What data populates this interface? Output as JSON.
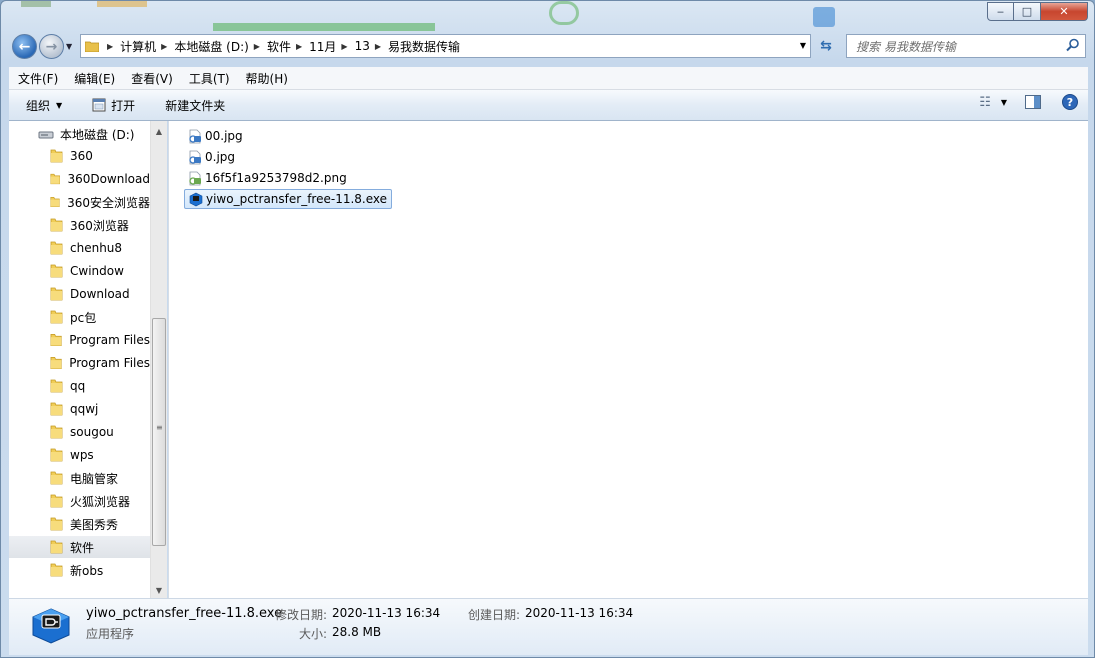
{
  "window": {
    "caption_buttons": {
      "minimize": "‒",
      "maximize": "□",
      "close": "✕"
    }
  },
  "nav": {
    "breadcrumbs": [
      "计算机",
      "本地磁盘 (D:)",
      "软件",
      "11月",
      "13",
      "易我数据传输"
    ],
    "search_placeholder": "搜索 易我数据传输"
  },
  "menu": [
    "文件(F)",
    "编辑(E)",
    "查看(V)",
    "工具(T)",
    "帮助(H)"
  ],
  "commands": {
    "organize": "组织",
    "open": "打开",
    "new_folder": "新建文件夹"
  },
  "sidebar": {
    "drive": "本地磁盘 (D:)",
    "folders": [
      "360",
      "360Download",
      "360安全浏览器",
      "360浏览器",
      "chenhu8",
      "Cwindow",
      "Download",
      "pc包",
      "Program Files",
      "Program Files",
      "qq",
      "qqwj",
      "sougou",
      "wps",
      "电脑管家",
      "火狐浏览器",
      "美图秀秀",
      "软件",
      "新obs"
    ],
    "selected": "软件"
  },
  "files": [
    {
      "name": "00.jpg",
      "type": "jpg",
      "selected": false
    },
    {
      "name": "0.jpg",
      "type": "jpg",
      "selected": false
    },
    {
      "name": "16f5f1a9253798d2.png",
      "type": "png",
      "selected": false
    },
    {
      "name": "yiwo_pctransfer_free-11.8.exe",
      "type": "exe",
      "selected": true
    }
  ],
  "details": {
    "file_name": "yiwo_pctransfer_free-11.8.exe",
    "file_type": "应用程序",
    "modified_label": "修改日期:",
    "modified_value": "2020-11-13 16:34",
    "created_label": "创建日期:",
    "created_value": "2020-11-13 16:34",
    "size_label": "大小:",
    "size_value": "28.8 MB"
  },
  "colors": {
    "accent": "#2a68b5",
    "selection_bg": "#d3e7fb",
    "selection_border": "#84acdd"
  }
}
